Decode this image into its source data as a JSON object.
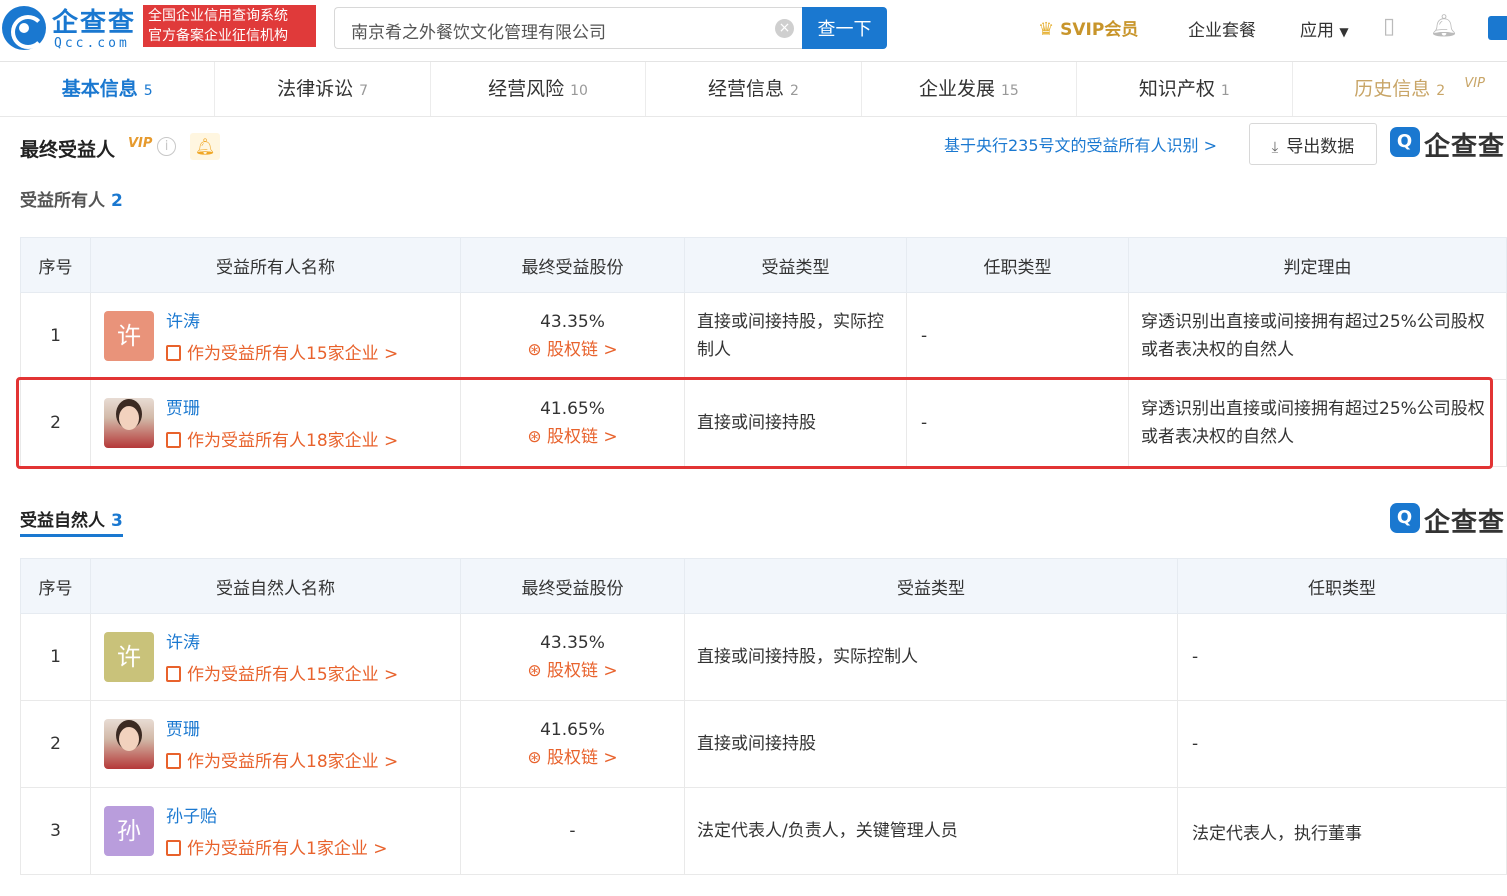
{
  "header": {
    "logo_cn": "企查查",
    "logo_en": "Qcc.com",
    "slogan_line1": "全国企业信用查询系统",
    "slogan_line2": "官方备案企业征信机构",
    "search_value": "南京肴之外餐饮文化管理有限公司",
    "search_button": "查一下",
    "svip": "SVIP会员",
    "package": "企业套餐",
    "apps": "应用"
  },
  "tabs": [
    {
      "label": "基本信息",
      "count": "5"
    },
    {
      "label": "法律诉讼",
      "count": "7"
    },
    {
      "label": "经营风险",
      "count": "10"
    },
    {
      "label": "经营信息",
      "count": "2"
    },
    {
      "label": "企业发展",
      "count": "15"
    },
    {
      "label": "知识产权",
      "count": "1"
    },
    {
      "label": "历史信息",
      "count": "2",
      "badge": "VIP"
    }
  ],
  "section": {
    "title": "最终受益人",
    "vip": "VIP",
    "pboc_link": "基于央行235号文的受益所有人识别 >",
    "export": "导出数据",
    "watermark": "企查查"
  },
  "owners": {
    "title": "受益所有人",
    "count": "2",
    "headers": [
      "序号",
      "受益所有人名称",
      "最终受益股份",
      "受益类型",
      "任职类型",
      "判定理由"
    ],
    "rows": [
      {
        "idx": "1",
        "avatar": "许",
        "name": "许涛",
        "link": "作为受益所有人15家企业 >",
        "pct": "43.35%",
        "chain": "股权链 >",
        "type": "直接或间接持股，实际控制人",
        "role": "-",
        "reason": "穿透识别出直接或间接拥有超过25%公司股权或者表决权的自然人"
      },
      {
        "idx": "2",
        "avatar": "",
        "name": "贾珊",
        "link": "作为受益所有人18家企业 >",
        "pct": "41.65%",
        "chain": "股权链 >",
        "type": "直接或间接持股",
        "role": "-",
        "reason": "穿透识别出直接或间接拥有超过25%公司股权或者表决权的自然人"
      }
    ]
  },
  "naturals": {
    "title": "受益自然人",
    "count": "3",
    "watermark": "企查查",
    "headers": [
      "序号",
      "受益自然人名称",
      "最终受益股份",
      "受益类型",
      "任职类型"
    ],
    "rows": [
      {
        "idx": "1",
        "avatar": "许",
        "name": "许涛",
        "link": "作为受益所有人15家企业 >",
        "pct": "43.35%",
        "chain": "股权链 >",
        "type": "直接或间接持股，实际控制人",
        "role": "-"
      },
      {
        "idx": "2",
        "avatar": "",
        "name": "贾珊",
        "link": "作为受益所有人18家企业 >",
        "pct": "41.65%",
        "chain": "股权链 >",
        "type": "直接或间接持股",
        "role": "-"
      },
      {
        "idx": "3",
        "avatar": "孙",
        "name": "孙子贻",
        "link": "作为受益所有人1家企业 >",
        "pct": "-",
        "chain": "",
        "type": "法定代表人/负责人，关键管理人员",
        "role": "法定代表人，执行董事"
      }
    ]
  },
  "colors": {
    "brand": "#1a78d0",
    "link_orange": "#e8622c",
    "highlight": "#e23434",
    "avatar_xu_owner": "#e9937a",
    "avatar_xu_natural": "#c9c27a",
    "avatar_sun": "#b99ddc"
  }
}
